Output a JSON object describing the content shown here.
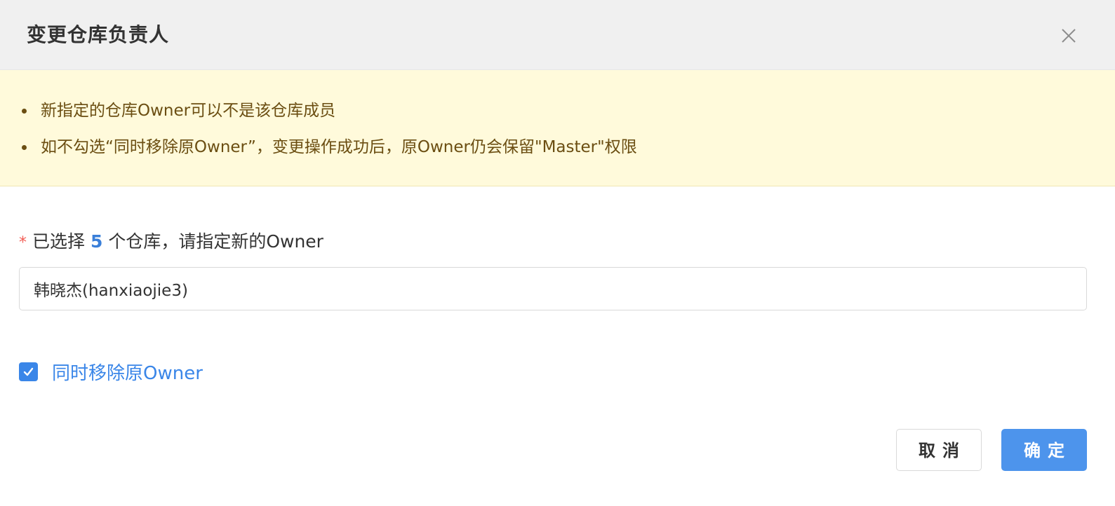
{
  "dialog": {
    "title": "变更仓库负责人",
    "close_icon": "close-icon"
  },
  "alert": {
    "items": [
      "新指定的仓库Owner可以不是该仓库成员",
      "如不勾选“同时移除原Owner”，变更操作成功后，原Owner仍会保留\"Master\"权限"
    ]
  },
  "form": {
    "required_mark": "*",
    "label_prefix": "已选择",
    "selected_count": "5",
    "label_suffix": "个仓库，请指定新的Owner",
    "owner_value": "韩晓杰(hanxiaojie3)",
    "remove_original_checked": true,
    "remove_original_label": "同时移除原Owner",
    "check_icon": "checkmark-icon"
  },
  "footer": {
    "cancel_label": "取消",
    "confirm_label": "确定"
  },
  "colors": {
    "header_bg": "#f0f0f0",
    "alert_bg": "#fffadb",
    "alert_text": "#6b4e12",
    "accent": "#3a86e8",
    "required": "#f25c54",
    "primary_button": "#4d94ec"
  }
}
